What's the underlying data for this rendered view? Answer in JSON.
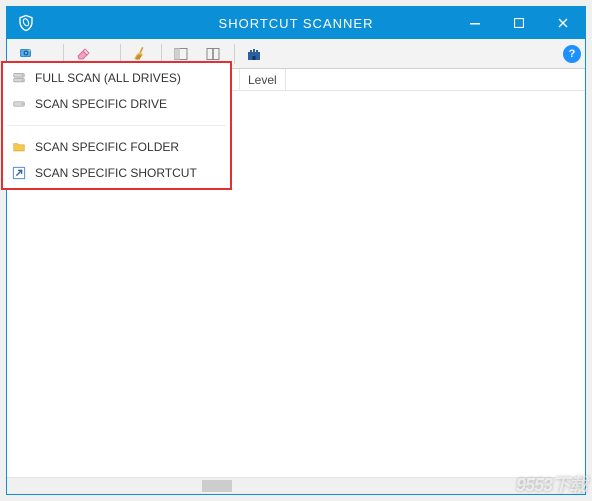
{
  "window": {
    "title": "SHORTCUT SCANNER"
  },
  "columns": {
    "level": "Level"
  },
  "menu": {
    "full_scan": "FULL SCAN (ALL DRIVES)",
    "scan_drive": "SCAN SPECIFIC DRIVE",
    "scan_folder": "SCAN SPECIFIC FOLDER",
    "scan_shortcut": "SCAN SPECIFIC SHORTCUT"
  },
  "help": "?",
  "watermark": "9553下载"
}
